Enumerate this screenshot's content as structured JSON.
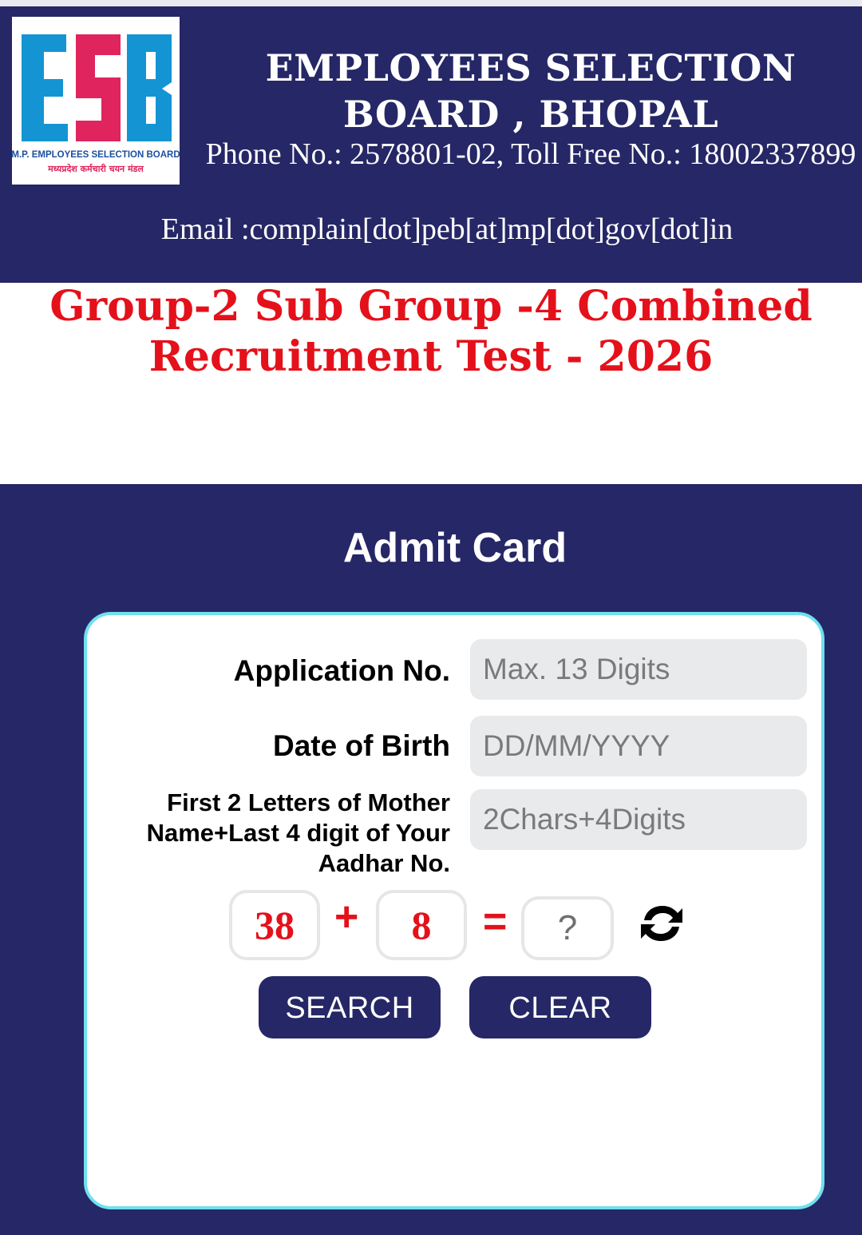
{
  "header": {
    "logo": {
      "mark_text": "ESB",
      "line1": "M.P. EMPLOYEES SELECTION BOARD",
      "line2": "मध्यप्रदेश कर्मचारी चयन मंडल",
      "color_blue": "#1594d3",
      "color_pink": "#e0245e"
    },
    "title": "EMPLOYEES SELECTION BOARD , BHOPAL",
    "phone": "Phone No.: 2578801-02, Toll Free No.: 18002337899",
    "email": "Email :complain[dot]peb[at]mp[dot]gov[dot]in"
  },
  "exam_title": "Group-2 Sub Group -4 Combined Recruitment Test - 2026",
  "admit_card": {
    "heading": "Admit Card",
    "fields": {
      "application_label": "Application No.",
      "application_placeholder": "Max. 13 Digits",
      "dob_label": "Date of Birth",
      "dob_placeholder": "DD/MM/YYYY",
      "mother_aadhar_label": "First 2 Letters of Mother Name+Last 4 digit of Your Aadhar No.",
      "mother_aadhar_placeholder": "2Chars+4Digits"
    },
    "captcha": {
      "num1": "38",
      "operator": "+",
      "num2": "8",
      "equals": "=",
      "answer_placeholder": "?",
      "refresh_icon": "refresh-icon"
    },
    "buttons": {
      "search": "SEARCH",
      "clear": "CLEAR"
    }
  },
  "colors": {
    "navy": "#262766",
    "title_red": "#e4111b",
    "card_border": "#6fe0ee"
  }
}
